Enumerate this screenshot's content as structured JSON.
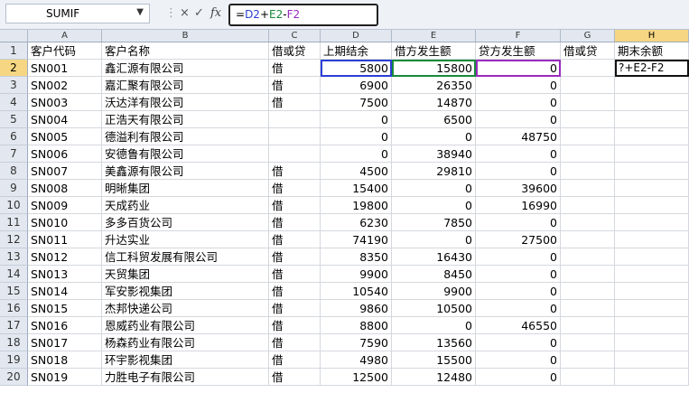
{
  "formula_bar": {
    "name_box": "SUMIF",
    "cancel_icon": "×",
    "enter_icon": "✓",
    "fx_label": "fx",
    "formula_parts": [
      "=",
      "D2",
      "+",
      "E2",
      "-",
      "F2"
    ]
  },
  "columns": [
    "A",
    "B",
    "C",
    "D",
    "E",
    "F",
    "G",
    "H"
  ],
  "active_column": "H",
  "active_row": 2,
  "headers": [
    "客户代码",
    "客户名称",
    "借或贷",
    "上期结余",
    "借方发生额",
    "贷方发生额",
    "借或贷",
    "期末余额"
  ],
  "editing_cell_text": "?+E2-F2",
  "rows": [
    {
      "n": 2,
      "cells": [
        "SN001",
        "鑫汇源有限公司",
        "借",
        "5800",
        "15800",
        "0",
        "",
        ""
      ]
    },
    {
      "n": 3,
      "cells": [
        "SN002",
        "嘉汇聚有限公司",
        "借",
        "6900",
        "26350",
        "0",
        "",
        ""
      ]
    },
    {
      "n": 4,
      "cells": [
        "SN003",
        "沃达洋有限公司",
        "借",
        "7500",
        "14870",
        "0",
        "",
        ""
      ]
    },
    {
      "n": 5,
      "cells": [
        "SN004",
        "正浩天有限公司",
        "",
        "0",
        "6500",
        "0",
        "",
        ""
      ]
    },
    {
      "n": 6,
      "cells": [
        "SN005",
        "德溢利有限公司",
        "",
        "0",
        "0",
        "48750",
        "",
        ""
      ]
    },
    {
      "n": 7,
      "cells": [
        "SN006",
        "安德鲁有限公司",
        "",
        "0",
        "38940",
        "0",
        "",
        ""
      ]
    },
    {
      "n": 8,
      "cells": [
        "SN007",
        "美鑫源有限公司",
        "借",
        "4500",
        "29810",
        "0",
        "",
        ""
      ]
    },
    {
      "n": 9,
      "cells": [
        "SN008",
        "明晰集团",
        "借",
        "15400",
        "0",
        "39600",
        "",
        ""
      ]
    },
    {
      "n": 10,
      "cells": [
        "SN009",
        "天成药业",
        "借",
        "19800",
        "0",
        "16990",
        "",
        ""
      ]
    },
    {
      "n": 11,
      "cells": [
        "SN010",
        "多多百货公司",
        "借",
        "6230",
        "7850",
        "0",
        "",
        ""
      ]
    },
    {
      "n": 12,
      "cells": [
        "SN011",
        "升达实业",
        "借",
        "74190",
        "0",
        "27500",
        "",
        ""
      ]
    },
    {
      "n": 13,
      "cells": [
        "SN012",
        "信工科贸发展有限公司",
        "借",
        "8350",
        "16430",
        "0",
        "",
        ""
      ]
    },
    {
      "n": 14,
      "cells": [
        "SN013",
        "天贸集团",
        "借",
        "9900",
        "8450",
        "0",
        "",
        ""
      ]
    },
    {
      "n": 15,
      "cells": [
        "SN014",
        "军安影视集团",
        "借",
        "10540",
        "9900",
        "0",
        "",
        ""
      ]
    },
    {
      "n": 16,
      "cells": [
        "SN015",
        "杰邦快递公司",
        "借",
        "9860",
        "10500",
        "0",
        "",
        ""
      ]
    },
    {
      "n": 17,
      "cells": [
        "SN016",
        "恩威药业有限公司",
        "借",
        "8800",
        "0",
        "46550",
        "",
        ""
      ]
    },
    {
      "n": 18,
      "cells": [
        "SN017",
        "杨森药业有限公司",
        "借",
        "7590",
        "13560",
        "0",
        "",
        ""
      ]
    },
    {
      "n": 19,
      "cells": [
        "SN018",
        "环宇影视集团",
        "借",
        "4980",
        "15500",
        "0",
        "",
        ""
      ]
    },
    {
      "n": 20,
      "cells": [
        "SN019",
        "力胜电子有限公司",
        "借",
        "12500",
        "12480",
        "0",
        "",
        ""
      ]
    }
  ]
}
